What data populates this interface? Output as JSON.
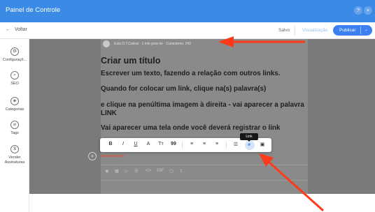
{
  "app": {
    "title": "Painel de Controle"
  },
  "window_controls": {
    "help": "?",
    "close": "×"
  },
  "topbar": {
    "back_label": "Voltar",
    "back_arrow": "←",
    "saved_label": "Salvo",
    "preview_label": "Visualização",
    "publish_label": "Publicar",
    "publish_chevron": "⌄"
  },
  "sidebar": {
    "items": [
      {
        "label": "Configuraçõ...",
        "icon": "gear-icon",
        "glyph": "⚙"
      },
      {
        "label": "SEO",
        "icon": "search-icon",
        "glyph": "⌕"
      },
      {
        "label": "Categorias",
        "icon": "categories-icon",
        "glyph": "◈"
      },
      {
        "label": "Tags",
        "icon": "tag-icon",
        "glyph": "⌀"
      },
      {
        "label": "Vender Assinaturas",
        "icon": "dollar-icon",
        "glyph": "$"
      }
    ]
  },
  "post": {
    "author_line": "Eula D.T.Cabral  ·  1 min para ler  ·  Caracteres: 242",
    "title": "Criar um título",
    "paragraphs": [
      "Escrever um texto, fazendo a relação com outros links.",
      "Quando for colocar um link, clique na(s) palavra(s)",
      "e clique na penúltima imagem à direita - vai aparecer a palavra LINK",
      "Vai aparecer uma tela onde você deverá registrar o link"
    ],
    "selected_text": "ooooooooooo"
  },
  "toolbar": {
    "bold": "B",
    "italic": "I",
    "underline": "U",
    "font_color": "A",
    "text_size": "Tт",
    "quote": "99",
    "align_left": "≡",
    "align_center": "≡",
    "align_right": "≡",
    "list": "☰",
    "link": "⚭",
    "image": "▣",
    "tooltip": "Link"
  },
  "insert_bar": {
    "icons": [
      "camera-icon",
      "gallery-icon",
      "video-icon",
      "divider-icon",
      "code-icon",
      "gif-icon",
      "image-icon",
      "upload-icon"
    ],
    "glyphs": [
      "◉",
      "▦",
      "▷",
      "☰",
      "</>",
      "GIF",
      "▢",
      "⇪"
    ]
  },
  "colors": {
    "titlebar": "#3b8ae6",
    "publish": "#3b7ff0",
    "annotation_arrow": "#ff3a1a"
  }
}
